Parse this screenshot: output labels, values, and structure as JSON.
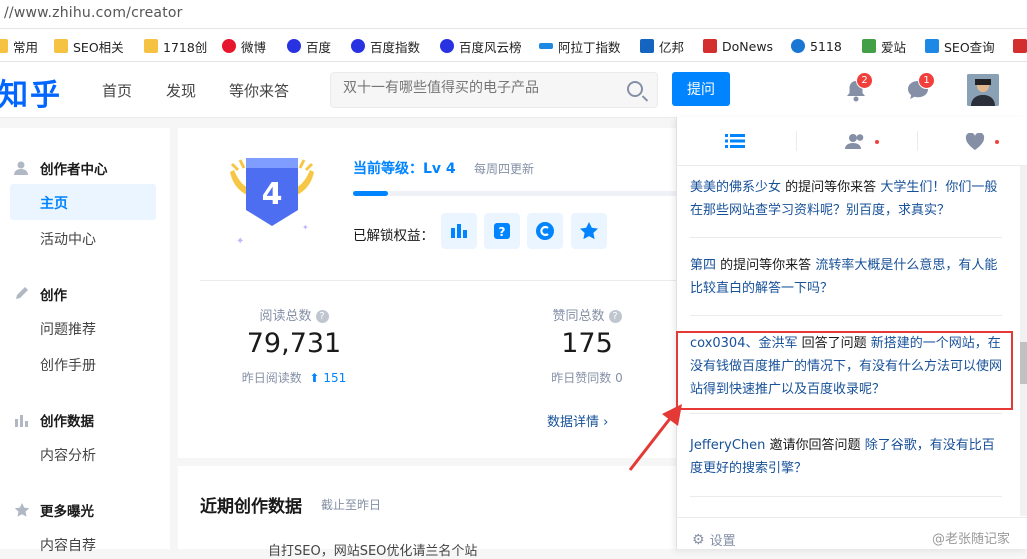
{
  "address": {
    "url": "//www.zhihu.com/creator"
  },
  "bookmarks": [
    {
      "label": "常用",
      "icon": "folder-icon",
      "color": "#f5c242"
    },
    {
      "label": "SEO相关",
      "icon": "folder-icon",
      "color": "#f5c242"
    },
    {
      "label": "1718创",
      "icon": "folder-icon",
      "color": "#f5c242"
    },
    {
      "label": "微博",
      "icon": "weibo-icon",
      "color": "#e6162d"
    },
    {
      "label": "百度",
      "icon": "baidu-paw-icon",
      "color": "#2932e1"
    },
    {
      "label": "百度指数",
      "icon": "baidu-paw-icon",
      "color": "#2932e1"
    },
    {
      "label": "百度风云榜",
      "icon": "baidu-paw-icon",
      "color": "#2932e1"
    },
    {
      "label": "阿拉丁指数",
      "icon": "aladdin-icon",
      "color": "#1e88e5"
    },
    {
      "label": "亿邦",
      "icon": "yibang-icon",
      "color": "#1565c0"
    },
    {
      "label": "DoNews",
      "icon": "donews-icon",
      "color": "#d32f2f"
    },
    {
      "label": "5118",
      "icon": "5118-icon",
      "color": "#1976d2"
    },
    {
      "label": "爱站",
      "icon": "aizhan-icon",
      "color": "#43a047"
    },
    {
      "label": "SEO查询",
      "icon": "seo-query-icon",
      "color": "#1e88e5"
    }
  ],
  "header": {
    "logo": "知乎",
    "nav": [
      "首页",
      "发现",
      "等你来答"
    ],
    "search_placeholder": "双十一有哪些值得买的电子产品",
    "ask_button": "提问",
    "notifications_count": "2",
    "messages_count": "1"
  },
  "sidebar": {
    "sections": [
      {
        "title": "创作者中心",
        "icon": "user-icon",
        "items": [
          "主页",
          "活动中心"
        ]
      },
      {
        "title": "创作",
        "icon": "pencil-icon",
        "items": [
          "问题推荐",
          "创作手册"
        ]
      },
      {
        "title": "创作数据",
        "icon": "bar-chart-icon",
        "items": [
          "内容分析"
        ]
      },
      {
        "title": "更多曝光",
        "icon": "star-icon",
        "items": [
          "内容自荐"
        ]
      }
    ],
    "active_item": "主页"
  },
  "level": {
    "badge_number": "4",
    "title": "当前等级：Lv 4",
    "update_note": "每周四更新",
    "progress_fraction": 0.1,
    "rights_label": "已解锁权益："
  },
  "stats": {
    "reads_label": "阅读总数",
    "reads_value": "79,731",
    "reads_yesterday_label": "昨日阅读数",
    "reads_yesterday_value": "151",
    "likes_label": "赞同总数",
    "likes_value": "175",
    "likes_yesterday_label": "昨日赞同数",
    "likes_yesterday_value": "0",
    "details_link": "数据详情"
  },
  "recent": {
    "title": "近期创作数据",
    "subtitle": "截止至昨日",
    "cut_text": "自打SEO，网站SEO优化请兰名个站"
  },
  "notifications": {
    "items": [
      {
        "user": "美美的佛系少女",
        "action": "的提问等你来答",
        "question": "大学生们！你们一般在那些网站查学习资料呢？别百度，求真实？"
      },
      {
        "user": "第四",
        "action": "的提问等你来答",
        "question": "流转率大概是什么意思，有人能比较直白的解答一下吗？"
      },
      {
        "user": "cox0304、金洪军",
        "action": "回答了问题",
        "question": "新搭建的一个网站，在没有钱做百度推广的情况下，有没有什么方法可以使网站得到快速推广以及百度收录呢？"
      },
      {
        "user": "JefferyChen",
        "action": "邀请你回答问题",
        "question": "除了谷歌，有没有比百度更好的搜索引擎？"
      }
    ],
    "settings_label": "设置"
  },
  "watermark": "@老张随记家"
}
